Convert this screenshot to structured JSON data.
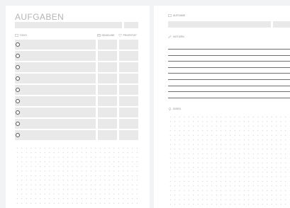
{
  "left_page": {
    "title": "AUFGABEN",
    "columns": {
      "todo": "TODO",
      "deadline": "DEADLINE",
      "priority": "PRIORITÄT"
    },
    "task_rows": [
      "",
      "",
      "",
      "",
      "",
      "",
      "",
      "",
      ""
    ]
  },
  "right_page": {
    "task_label": "AUFGABE",
    "notes_label": "NOTIZEN",
    "ideas_label": "IDEEN",
    "note_lines": [
      "",
      "",
      "",
      "",
      "",
      "",
      "",
      "",
      ""
    ]
  },
  "colors": {
    "cell_fill": "#e9e9e9",
    "page": "#ffffff",
    "background": "#f1f3f4",
    "rule_line": "#6e6e6e"
  },
  "icons": [
    "document-icon",
    "calendar-icon",
    "heart-icon",
    "pencil-icon",
    "lightbulb-icon"
  ]
}
